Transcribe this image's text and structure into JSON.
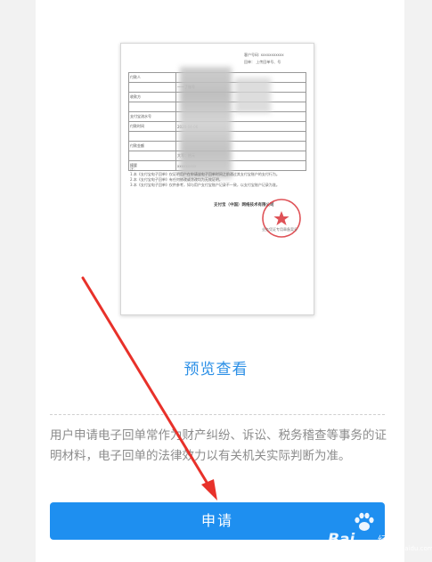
{
  "document": {
    "top_line": "客户号码: xxxxxxxxxxx",
    "top_line2": "回单： 上传回单号、号",
    "rows": [
      {
        "label": "付款人",
        "value": ""
      },
      {
        "label": "",
        "value": "——了账号"
      },
      {
        "label": "收款方",
        "value": ""
      },
      {
        "label": "",
        "value": ""
      },
      {
        "label": "支付宝流水号",
        "value": ""
      },
      {
        "label": "付款时间",
        "value": "2020-04-06"
      },
      {
        "label": "",
        "value": ""
      },
      {
        "label": "付款金额",
        "value": ""
      },
      {
        "label": "",
        "value": "大写：拾元"
      },
      {
        "label": "摘要",
        "value": "xxxxxxxxx"
      }
    ],
    "notes": [
      "注：",
      "1.本《支付宝电子回单》仅证明用户在申请该电子回单时间之前通过其支付宝账户的支付行为。",
      "2.本《支付宝电子回单》有任何修改或涂改均为无效证明。",
      "3.本《支付宝电子回单》仅供参考，如与用户支付宝账户记录不一致，以支付宝账户记录为准。"
    ],
    "signature": "支付宝（中国）网络技术有限公司",
    "seal_note": "业务凭证专用章备案号",
    "seal_text": "支付宝（中国）网络技术有限公司"
  },
  "preview": {
    "label": "预览查看"
  },
  "description": "用户申请电子回单常作为财产纠纷、诉讼、税务稽查等事务的证明材料，电子回单的法律效力以有关机关实际判断为准。",
  "apply_button": {
    "label": "申请"
  },
  "watermark": {
    "brand": "Bai",
    "brand2": "经验",
    "url": "jingyan.baidu.com"
  },
  "colors": {
    "accent": "#1e8ff0",
    "link": "#2b8fe6",
    "arrow": "#e8312a",
    "seal": "#d9343a"
  },
  "icons": {
    "seal": "red-seal-icon",
    "paw": "baidu-paw-icon",
    "arrow": "red-arrow-annotation"
  }
}
